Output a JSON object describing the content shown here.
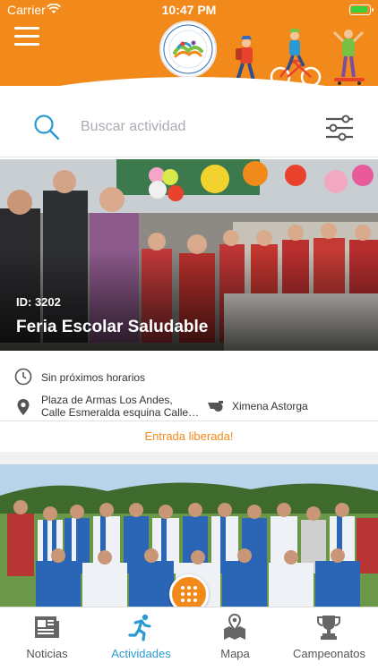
{
  "status_bar": {
    "carrier": "Carrier",
    "time": "10:47 PM"
  },
  "header": {
    "logo": "municipal-sports-logo",
    "menu_icon": "hamburger-icon"
  },
  "search": {
    "placeholder": "Buscar actividad",
    "value": ""
  },
  "activities": [
    {
      "id_label": "ID: 3202",
      "title": "Feria Escolar Saludable",
      "schedule": "Sin próximos horarios",
      "location_line1": "Plaza de Armas Los Andes,",
      "location_line2": "Calle Esmeralda esquina Calle…",
      "organizer": "Ximena Astorga",
      "entry": "Entrada liberada!"
    }
  ],
  "tabs": [
    {
      "label": "Noticias",
      "icon": "newspaper-icon",
      "active": false
    },
    {
      "label": "Actividades",
      "icon": "runner-icon",
      "active": true
    },
    {
      "label": "Mapa",
      "icon": "map-icon",
      "active": false
    },
    {
      "label": "Campeonatos",
      "icon": "trophy-icon",
      "active": false
    }
  ],
  "colors": {
    "brand_orange": "#f28a1b",
    "active_blue": "#2a9bd2"
  }
}
